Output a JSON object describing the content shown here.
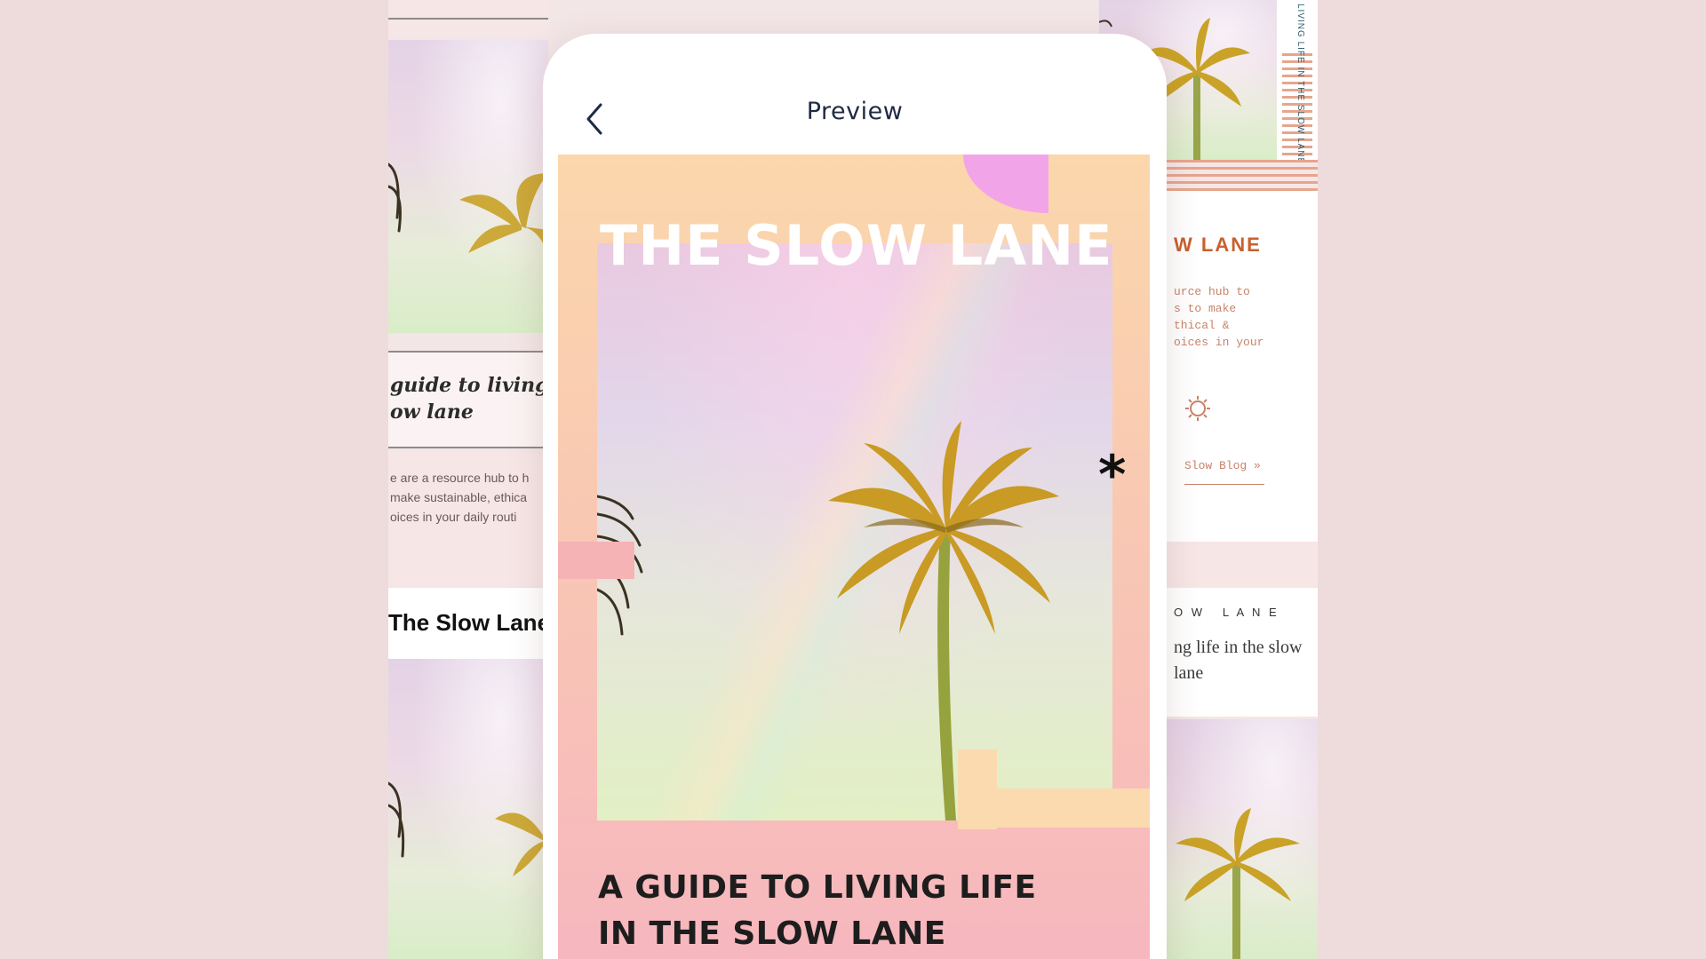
{
  "preview": {
    "title": "Preview",
    "back_icon": "chevron-left-icon"
  },
  "story": {
    "title": "THE SLOW LANE",
    "subtitle_line1": "A GUIDE TO LIVING LIFE",
    "subtitle_line2": "IN THE SLOW LANE",
    "decor_symbol": "*"
  },
  "left_templates": {
    "guide_line1": "guide to living lif",
    "guide_line2": "ow lane",
    "body_line1": "e are a resource hub to h",
    "body_line2": "make sustainable, ethica",
    "body_line3": "oices in your daily routi",
    "brand": "The Slow Lane"
  },
  "right_templates": {
    "vertical_text": "LIVING LIFE IN THE SLOW LANE",
    "heading": "W LANE",
    "body_line1": "urce hub to",
    "body_line2": "s to make",
    "body_line3": "thical &",
    "body_line4": "oices in your",
    "body_line5": "",
    "link": "Slow Blog »",
    "spaced_title": "O W   L A N E",
    "serif_line1": "ng life in the slow",
    "serif_line2": "lane"
  },
  "colors": {
    "background": "#eedcdc",
    "accent_orange": "#c8602e",
    "accent_pink": "#f2a4e8",
    "story_pink": "#f6b6bf",
    "story_peach": "#fbd7ac",
    "title_navy": "#1f2a44"
  }
}
